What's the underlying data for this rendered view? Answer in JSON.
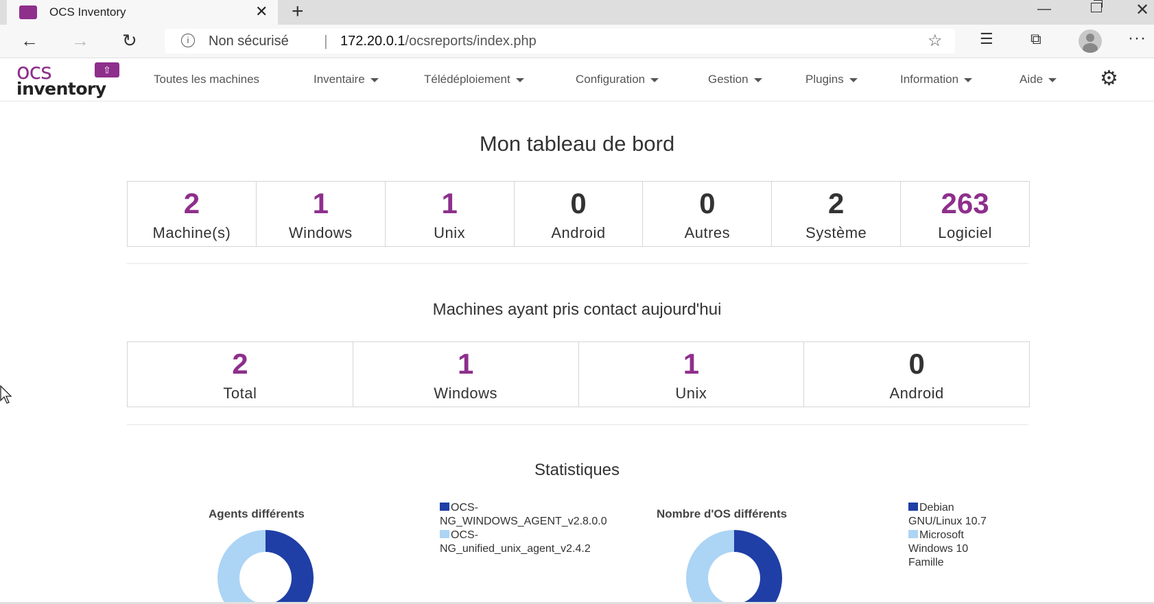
{
  "browser": {
    "tab_title": "OCS Inventory",
    "new_tab": "+",
    "url_security": "Non sécurisé",
    "url_separator": "|",
    "url_host": "172.20.0.1",
    "url_path": "/ocsreports/index.php"
  },
  "app": {
    "logo_top": "ocs",
    "logo_bottom": "inventory",
    "nav": [
      {
        "label": "Toutes les machines",
        "dropdown": false
      },
      {
        "label": "Inventaire",
        "dropdown": true
      },
      {
        "label": "Télédéploiement",
        "dropdown": true
      },
      {
        "label": "Configuration",
        "dropdown": true
      },
      {
        "label": "Gestion",
        "dropdown": true
      },
      {
        "label": "Plugins",
        "dropdown": true
      },
      {
        "label": "Information",
        "dropdown": true
      },
      {
        "label": "Aide",
        "dropdown": true
      }
    ],
    "accent_color": "#8e2f8c"
  },
  "dashboard": {
    "title": "Mon tableau de bord",
    "summary": [
      {
        "value": "2",
        "label": "Machine(s)",
        "color": "purple"
      },
      {
        "value": "1",
        "label": "Windows",
        "color": "purple"
      },
      {
        "value": "1",
        "label": "Unix",
        "color": "purple"
      },
      {
        "value": "0",
        "label": "Android",
        "color": "dark"
      },
      {
        "value": "0",
        "label": "Autres",
        "color": "dark"
      },
      {
        "value": "2",
        "label": "Système",
        "color": "dark"
      },
      {
        "value": "263",
        "label": "Logiciel",
        "color": "purple"
      }
    ],
    "contact_title": "Machines ayant pris contact aujourd'hui",
    "contact": [
      {
        "value": "2",
        "label": "Total",
        "color": "purple"
      },
      {
        "value": "1",
        "label": "Windows",
        "color": "purple"
      },
      {
        "value": "1",
        "label": "Unix",
        "color": "purple"
      },
      {
        "value": "0",
        "label": "Android",
        "color": "dark"
      }
    ],
    "stats_title": "Statistiques"
  },
  "chart_data": [
    {
      "type": "pie",
      "title": "Agents différents",
      "donut": true,
      "categories": [
        "OCS-NG_WINDOWS_AGENT_v2.8.0.0",
        "OCS-NG_unified_unix_agent_v2.4.2"
      ],
      "legend_lines": [
        [
          "OCS-",
          "NG_WINDOWS_AGENT_v2.8.0.0"
        ],
        [
          "OCS-",
          "NG_unified_unix_agent_v2.4.2"
        ]
      ],
      "values": [
        1,
        1
      ],
      "colors": [
        "#1f3fa6",
        "#acd4f5"
      ]
    },
    {
      "type": "pie",
      "title": "Nombre d'OS différents",
      "donut": true,
      "categories": [
        "Debian GNU/Linux 10.7",
        "Microsoft Windows 10 Famille"
      ],
      "legend_lines": [
        [
          "Debian",
          "GNU/Linux 10.7"
        ],
        [
          "Microsoft",
          "Windows 10",
          "Famille"
        ]
      ],
      "values": [
        1,
        1
      ],
      "colors": [
        "#1f3fa6",
        "#acd4f5"
      ]
    }
  ]
}
